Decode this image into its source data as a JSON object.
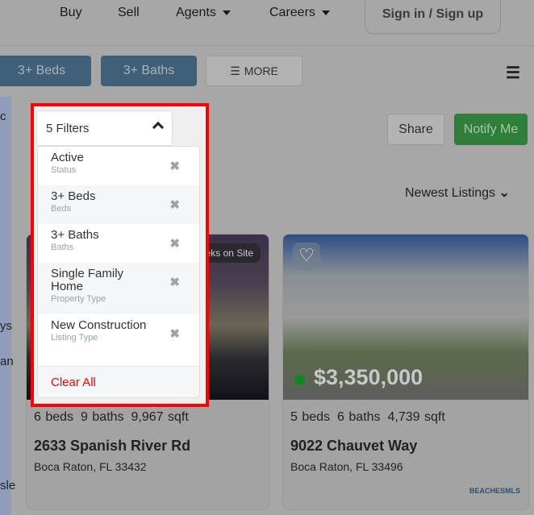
{
  "nav": {
    "buy": "Buy",
    "sell": "Sell",
    "agents": "Agents",
    "careers": "Careers",
    "signin": "Sign in / Sign up"
  },
  "filters_bar": {
    "beds": "3+ Beds",
    "baths": "3+ Baths",
    "more": "MORE"
  },
  "map": {
    "labels": [
      "c",
      "ys",
      "an",
      "sle"
    ]
  },
  "filter_dropdown": {
    "label": "5 Filters",
    "items": [
      {
        "title": "Active",
        "subtitle": "Status"
      },
      {
        "title": "3+ Beds",
        "subtitle": "Beds"
      },
      {
        "title": "3+ Baths",
        "subtitle": "Baths"
      },
      {
        "title": "Single Family Home",
        "subtitle": "Property Type"
      },
      {
        "title": "New Construction",
        "subtitle": "Listing Type"
      }
    ],
    "clear_all": "Clear All"
  },
  "actions": {
    "share": "Share",
    "notify": "Notify Me",
    "sort": "Newest Listings"
  },
  "listings": [
    {
      "badge": "Weeks on Site",
      "beds": "6 beds",
      "baths": "9 baths",
      "sqft": "9,967 sqft",
      "address": "2633 Spanish River Rd",
      "city": "Boca Raton, FL 33432"
    },
    {
      "price": "$3,350,000",
      "status_color": "#0d8a1c",
      "beds": "5 beds",
      "baths": "6 baths",
      "sqft": "4,739 sqft",
      "address": "9022 Chauvet Way",
      "city": "Boca Raton, FL 33496",
      "mls": "BEACHESMLS"
    }
  ],
  "colors": {
    "highlight": "#ff0000",
    "primary": "#405f78",
    "notify": "#2f7f3a"
  }
}
